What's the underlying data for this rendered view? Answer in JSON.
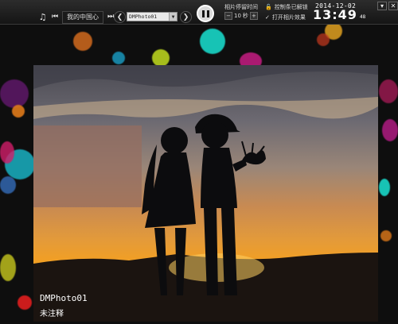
{
  "music": {
    "track": "我的中国心",
    "icons": [
      "music-note-icon",
      "prev-track-icon",
      "next-track-icon"
    ]
  },
  "photo_nav": {
    "prev": "❮",
    "next": "❯",
    "selected": "DMPhoto01"
  },
  "playback": {
    "state": "pause-icon"
  },
  "stay_time": {
    "label": "相片停留时间",
    "minus": "−",
    "value": "10",
    "unit": "秒",
    "plus": "+"
  },
  "options": {
    "lock_label": "控制条已解锁",
    "effects_label": "打开相片效果"
  },
  "clock": {
    "date": "2014-12-02",
    "time": "13:49",
    "seconds": "48"
  },
  "window": {
    "minimize": "▾",
    "close": "✕"
  },
  "caption": {
    "title": "DMPhoto01",
    "subtitle": "未注释"
  },
  "colors": {
    "accent_cyan": "#19d7c8",
    "sunset_orange": "#f4a020"
  }
}
